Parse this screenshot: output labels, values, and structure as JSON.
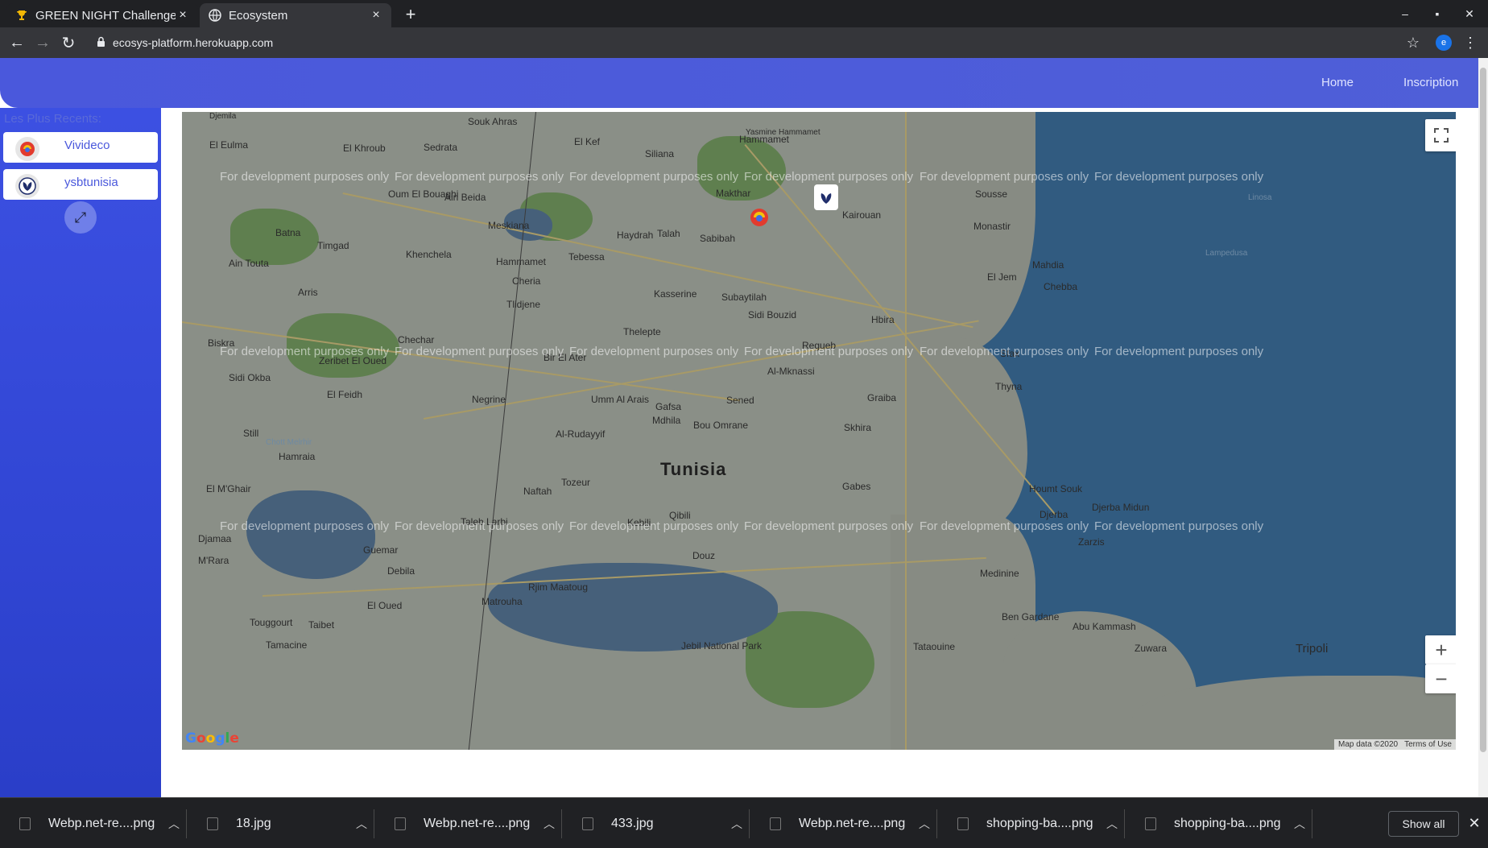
{
  "browser": {
    "tabs": [
      {
        "title": "GREEN NIGHT Challenge",
        "icon": "trophy-icon",
        "active": false
      },
      {
        "title": "Ecosystem",
        "icon": "globe-icon",
        "active": true
      }
    ],
    "url": "ecosys-platform.herokuapp.com",
    "profile_initial": "e"
  },
  "header": {
    "nav": [
      "Home",
      "Inscription"
    ]
  },
  "sidebar": {
    "title": "Les Plus Recents:",
    "companies": [
      {
        "name": "Vivideco",
        "logo": "vivideco-logo"
      },
      {
        "name": "ysbtunisia",
        "logo": "ysbtunisia-logo"
      }
    ]
  },
  "map": {
    "watermark": "For development purposes only",
    "country_label": "Tunisia",
    "places": [
      "Souk Ahras",
      "El Kef",
      "Siliana",
      "Hammamet",
      "Yasmine Hammamet",
      "El Eulma",
      "El Khroub",
      "Sedrata",
      "Djemila",
      "Oum El Bouaghi",
      "Ain Beida",
      "Meskiana",
      "Makthar",
      "Sousse",
      "Monastir",
      "Kairouan",
      "Batna",
      "Khenchela",
      "Tebessa",
      "Haydrah",
      "Talah",
      "Sabibah",
      "Ain Touta",
      "Timgad",
      "Hammamet",
      "Cheria",
      "Mahdia",
      "Kasserine",
      "Subaytilah",
      "Sidi Bouzid",
      "Chebba",
      "El Jem",
      "Arris",
      "Tlidjene",
      "Thelepte",
      "Biskra",
      "Chechar",
      "Bir El Ater",
      "Regueb",
      "Hbira",
      "Al-Mknassi",
      "Sfax",
      "Zeribet El Oued",
      "Sidi Okba",
      "El Feidh",
      "Negrine",
      "Umm Al Arais",
      "Thyna",
      "Graiba",
      "Gafsa",
      "Sened",
      "Mdhila",
      "Bou Omrane",
      "Skhira",
      "Al-Rudayyif",
      "Still",
      "Hamraia",
      "Chott Melrhir",
      "El M'Ghair",
      "Naftah",
      "Tozeur",
      "Gabes",
      "Houmt Souk",
      "Djerba Midun",
      "Djerba",
      "Zarzis",
      "Taleb Larbi",
      "Kebili",
      "Qibili",
      "Douz",
      "Medinine",
      "Djamaa",
      "Guemar",
      "M'Rara",
      "Debila",
      "Rjim Maatoug",
      "Matrouha",
      "El Oued",
      "Ben Gardane",
      "Abu Kammash",
      "Zuwara",
      "Tripoli",
      "Touggourt",
      "Taibet",
      "Tamacine",
      "Jebil National Park",
      "Tataouine",
      "Linosa",
      "Lampedusa"
    ],
    "zoom_in": "+",
    "zoom_out": "−",
    "attribution": [
      "Map data ©2020",
      "Terms of Use"
    ],
    "google_logo": "Google"
  },
  "downloads": {
    "items": [
      "Webp.net-re....png",
      "18.jpg",
      "Webp.net-re....png",
      "433.jpg",
      "Webp.net-re....png",
      "shopping-ba....png",
      "shopping-ba....png"
    ],
    "show_all": "Show all"
  }
}
